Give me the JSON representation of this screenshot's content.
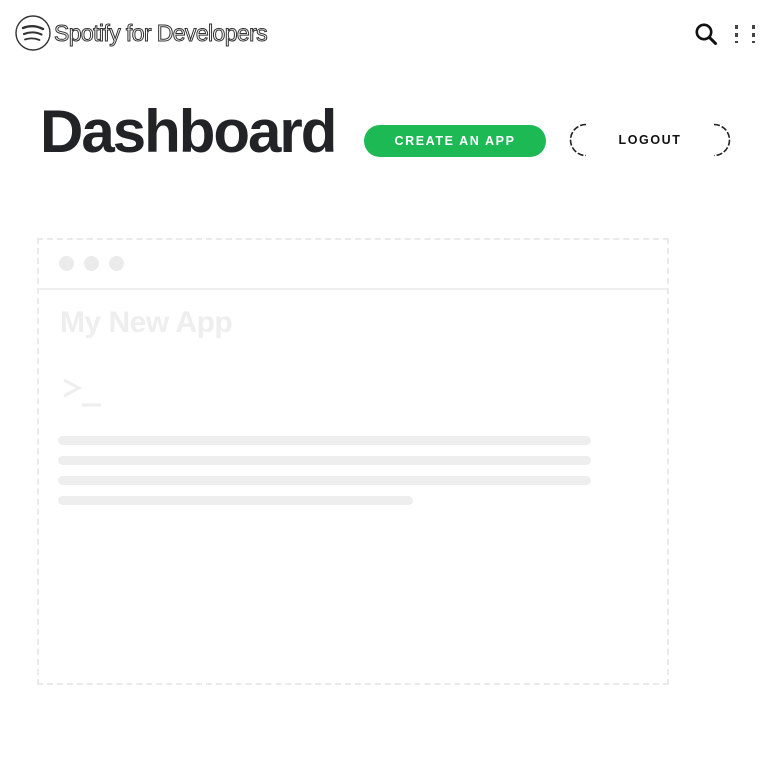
{
  "brand": {
    "name": "Spotify for Developers",
    "logo_icon": "spotify-logo-icon"
  },
  "nav": {
    "search_icon": "search-icon",
    "menu_icon": "menu-icon"
  },
  "header": {
    "title": "Dashboard",
    "create_app_label": "CREATE AN APP",
    "logout_label": "LOGOUT"
  },
  "placeholder_card": {
    "title": "My New App",
    "prompt_icon": "terminal-prompt-icon",
    "window_dots": 3,
    "skeleton_lines": 4
  },
  "colors": {
    "brand_green": "#1db954",
    "title_text": "#222326",
    "placeholder_gray": "#eeeeee"
  }
}
